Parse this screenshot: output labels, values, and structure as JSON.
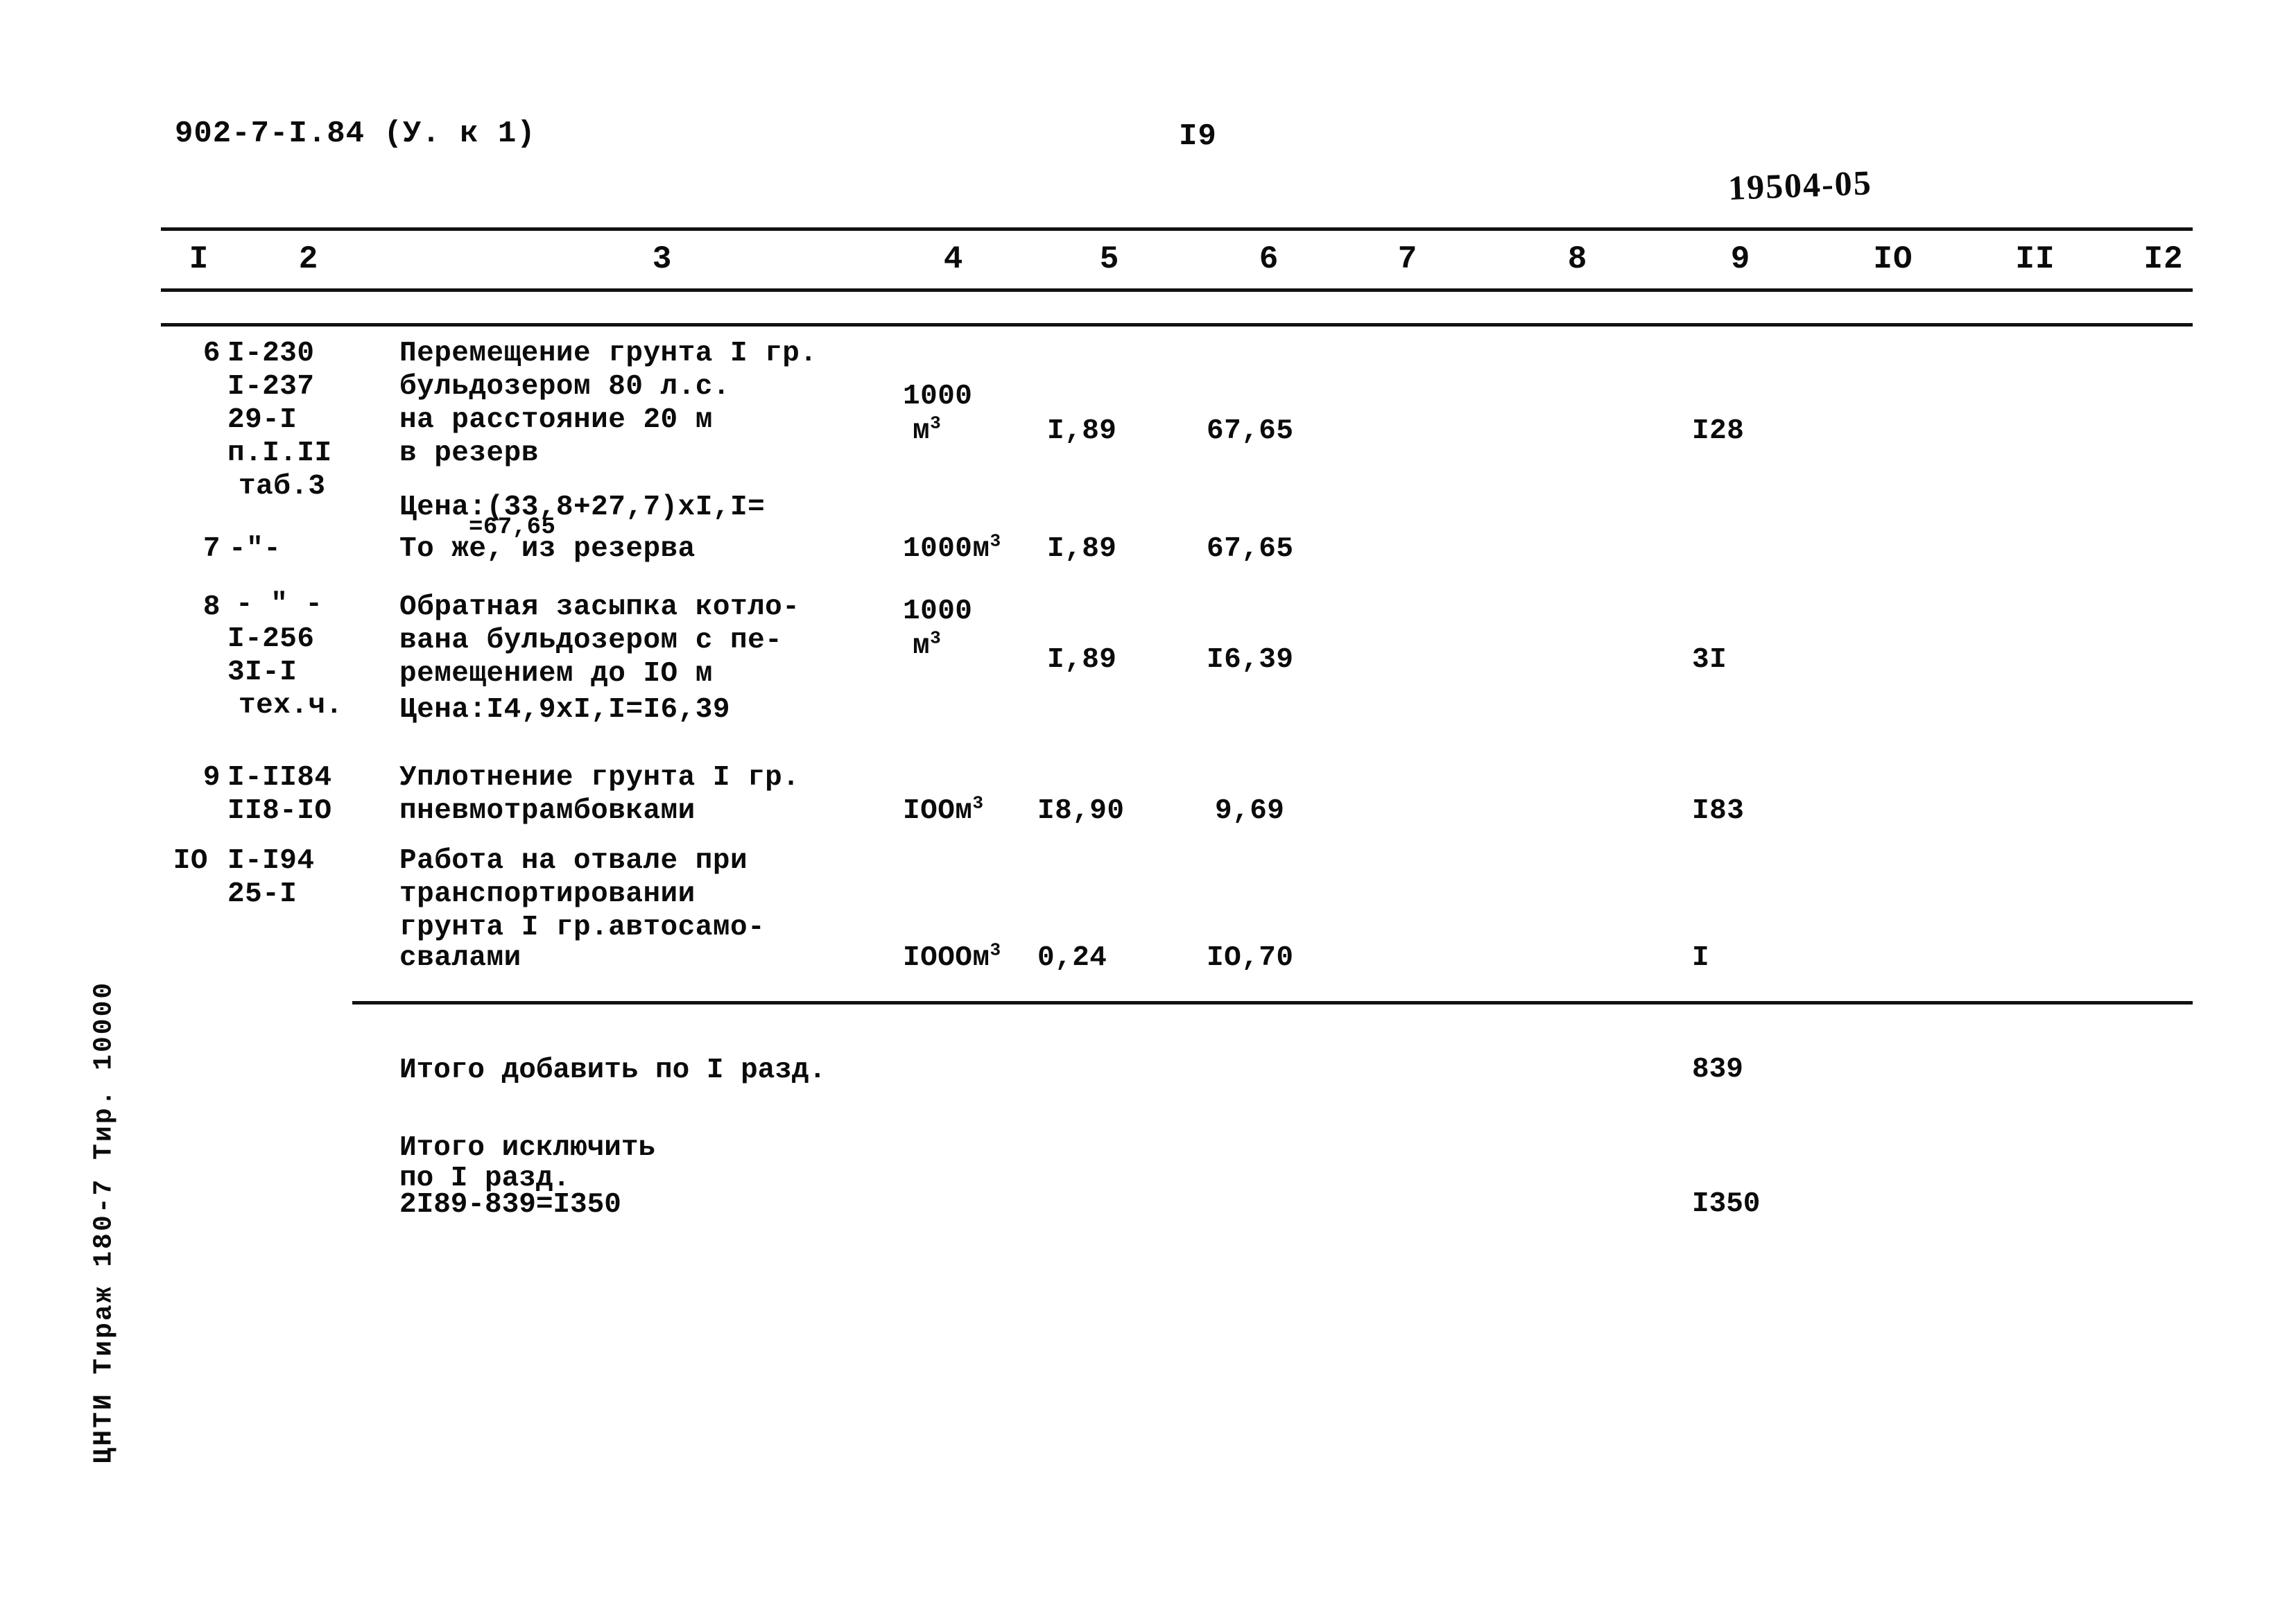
{
  "header": {
    "doc_code": "902-7-I.84 (У. к 1)",
    "page_number": "I9",
    "stamp": "19504-05"
  },
  "table": {
    "column_headers": [
      "I",
      "2",
      "3",
      "4",
      "5",
      "6",
      "7",
      "8",
      "9",
      "IO",
      "II",
      "I2"
    ],
    "rows": [
      {
        "no": "6",
        "codes": [
          "I-230",
          "I-237",
          "29-I",
          "п.I.II",
          "таб.3"
        ],
        "description": [
          "Перемещение грунта I гр.",
          "бульдозером 80 л.с.",
          "на расстояние 20 м",
          "в резерв"
        ],
        "price_note": "Цена:(33,8+27,7)xI,I=",
        "price_note_overstrike": "=67,65",
        "unit_top": "1000",
        "unit_bottom": "м",
        "unit_sup": "3",
        "qty": "I,89",
        "price": "67,65",
        "col7": "",
        "col8": "",
        "total": "I28",
        "col10": "",
        "col11": "",
        "col12": ""
      },
      {
        "no": "7",
        "codes": [
          "-\"-"
        ],
        "description": [
          "То же, из резерва"
        ],
        "unit_top": "",
        "unit_bottom": "1000м",
        "unit_sup": "3",
        "qty": "I,89",
        "price": "67,65",
        "col7": "",
        "col8": "",
        "total": "",
        "col10": "",
        "col11": "",
        "col12": ""
      },
      {
        "no": "8",
        "codes": [
          "- \" -",
          "I-256",
          "3I-I",
          "тех.ч."
        ],
        "description": [
          "Обратная засыпка котло-",
          "вана бульдозером с пе-",
          "ремещением до IO м"
        ],
        "price_note": "Цена:I4,9xI,I=I6,39",
        "unit_top": "1000",
        "unit_bottom": "м",
        "unit_sup": "3",
        "qty": "I,89",
        "price": "I6,39",
        "col7": "",
        "col8": "",
        "total": "3I",
        "col10": "",
        "col11": "",
        "col12": ""
      },
      {
        "no": "9",
        "codes": [
          "I-II84",
          "II8-IO"
        ],
        "description": [
          "Уплотнение грунта I гр.",
          "пневмотрамбовками"
        ],
        "unit_top": "",
        "unit_bottom": "IOOм",
        "unit_sup": "3",
        "qty": "I8,90",
        "price": "9,69",
        "col7": "",
        "col8": "",
        "total": "I83",
        "col10": "",
        "col11": "",
        "col12": ""
      },
      {
        "no": "IO",
        "codes": [
          "I-I94",
          "25-I"
        ],
        "description": [
          "Работа на отвале при",
          "транспортировании",
          "грунта I гр.автосамо-",
          "свалами"
        ],
        "unit_top": "",
        "unit_bottom": "IOOOм",
        "unit_sup": "3",
        "qty": "0,24",
        "price": "IO,70",
        "col7": "",
        "col8": "",
        "total": "I",
        "col10": "",
        "col11": "",
        "col12": ""
      }
    ],
    "totals": [
      {
        "label_lines": [
          "Итого добавить по I разд."
        ],
        "value": "839"
      },
      {
        "label_lines": [
          "Итого исключить",
          "по I разд.",
          "2I89-839=I350"
        ],
        "value": "I350"
      }
    ]
  },
  "footer": {
    "imprint": "ЦНТИ Тираж 180-7 Тир. 10000"
  }
}
